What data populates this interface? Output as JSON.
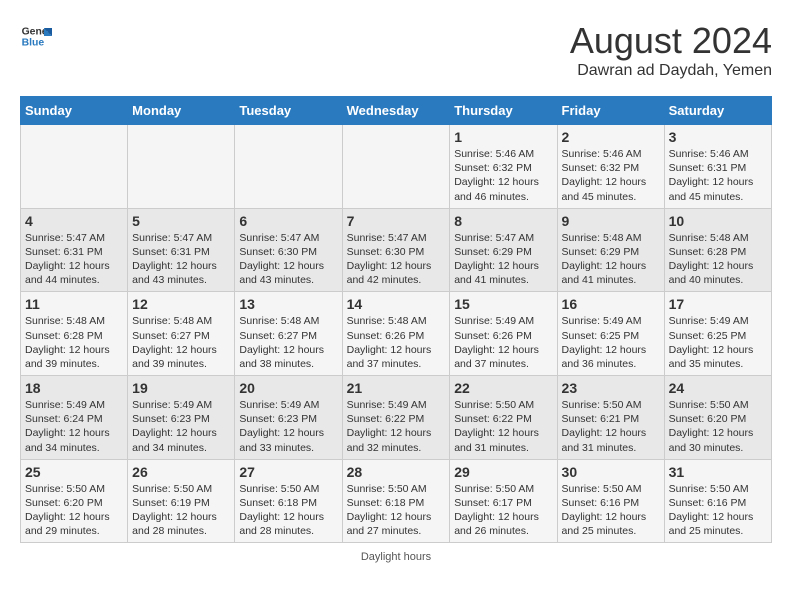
{
  "header": {
    "logo_line1": "General",
    "logo_line2": "Blue",
    "month_year": "August 2024",
    "location": "Dawran ad Daydah, Yemen"
  },
  "days_of_week": [
    "Sunday",
    "Monday",
    "Tuesday",
    "Wednesday",
    "Thursday",
    "Friday",
    "Saturday"
  ],
  "weeks": [
    [
      {
        "day": "",
        "info": ""
      },
      {
        "day": "",
        "info": ""
      },
      {
        "day": "",
        "info": ""
      },
      {
        "day": "",
        "info": ""
      },
      {
        "day": "1",
        "info": "Sunrise: 5:46 AM\nSunset: 6:32 PM\nDaylight: 12 hours and 46 minutes."
      },
      {
        "day": "2",
        "info": "Sunrise: 5:46 AM\nSunset: 6:32 PM\nDaylight: 12 hours and 45 minutes."
      },
      {
        "day": "3",
        "info": "Sunrise: 5:46 AM\nSunset: 6:31 PM\nDaylight: 12 hours and 45 minutes."
      }
    ],
    [
      {
        "day": "4",
        "info": "Sunrise: 5:47 AM\nSunset: 6:31 PM\nDaylight: 12 hours and 44 minutes."
      },
      {
        "day": "5",
        "info": "Sunrise: 5:47 AM\nSunset: 6:31 PM\nDaylight: 12 hours and 43 minutes."
      },
      {
        "day": "6",
        "info": "Sunrise: 5:47 AM\nSunset: 6:30 PM\nDaylight: 12 hours and 43 minutes."
      },
      {
        "day": "7",
        "info": "Sunrise: 5:47 AM\nSunset: 6:30 PM\nDaylight: 12 hours and 42 minutes."
      },
      {
        "day": "8",
        "info": "Sunrise: 5:47 AM\nSunset: 6:29 PM\nDaylight: 12 hours and 41 minutes."
      },
      {
        "day": "9",
        "info": "Sunrise: 5:48 AM\nSunset: 6:29 PM\nDaylight: 12 hours and 41 minutes."
      },
      {
        "day": "10",
        "info": "Sunrise: 5:48 AM\nSunset: 6:28 PM\nDaylight: 12 hours and 40 minutes."
      }
    ],
    [
      {
        "day": "11",
        "info": "Sunrise: 5:48 AM\nSunset: 6:28 PM\nDaylight: 12 hours and 39 minutes."
      },
      {
        "day": "12",
        "info": "Sunrise: 5:48 AM\nSunset: 6:27 PM\nDaylight: 12 hours and 39 minutes."
      },
      {
        "day": "13",
        "info": "Sunrise: 5:48 AM\nSunset: 6:27 PM\nDaylight: 12 hours and 38 minutes."
      },
      {
        "day": "14",
        "info": "Sunrise: 5:48 AM\nSunset: 6:26 PM\nDaylight: 12 hours and 37 minutes."
      },
      {
        "day": "15",
        "info": "Sunrise: 5:49 AM\nSunset: 6:26 PM\nDaylight: 12 hours and 37 minutes."
      },
      {
        "day": "16",
        "info": "Sunrise: 5:49 AM\nSunset: 6:25 PM\nDaylight: 12 hours and 36 minutes."
      },
      {
        "day": "17",
        "info": "Sunrise: 5:49 AM\nSunset: 6:25 PM\nDaylight: 12 hours and 35 minutes."
      }
    ],
    [
      {
        "day": "18",
        "info": "Sunrise: 5:49 AM\nSunset: 6:24 PM\nDaylight: 12 hours and 34 minutes."
      },
      {
        "day": "19",
        "info": "Sunrise: 5:49 AM\nSunset: 6:23 PM\nDaylight: 12 hours and 34 minutes."
      },
      {
        "day": "20",
        "info": "Sunrise: 5:49 AM\nSunset: 6:23 PM\nDaylight: 12 hours and 33 minutes."
      },
      {
        "day": "21",
        "info": "Sunrise: 5:49 AM\nSunset: 6:22 PM\nDaylight: 12 hours and 32 minutes."
      },
      {
        "day": "22",
        "info": "Sunrise: 5:50 AM\nSunset: 6:22 PM\nDaylight: 12 hours and 31 minutes."
      },
      {
        "day": "23",
        "info": "Sunrise: 5:50 AM\nSunset: 6:21 PM\nDaylight: 12 hours and 31 minutes."
      },
      {
        "day": "24",
        "info": "Sunrise: 5:50 AM\nSunset: 6:20 PM\nDaylight: 12 hours and 30 minutes."
      }
    ],
    [
      {
        "day": "25",
        "info": "Sunrise: 5:50 AM\nSunset: 6:20 PM\nDaylight: 12 hours and 29 minutes."
      },
      {
        "day": "26",
        "info": "Sunrise: 5:50 AM\nSunset: 6:19 PM\nDaylight: 12 hours and 28 minutes."
      },
      {
        "day": "27",
        "info": "Sunrise: 5:50 AM\nSunset: 6:18 PM\nDaylight: 12 hours and 28 minutes."
      },
      {
        "day": "28",
        "info": "Sunrise: 5:50 AM\nSunset: 6:18 PM\nDaylight: 12 hours and 27 minutes."
      },
      {
        "day": "29",
        "info": "Sunrise: 5:50 AM\nSunset: 6:17 PM\nDaylight: 12 hours and 26 minutes."
      },
      {
        "day": "30",
        "info": "Sunrise: 5:50 AM\nSunset: 6:16 PM\nDaylight: 12 hours and 25 minutes."
      },
      {
        "day": "31",
        "info": "Sunrise: 5:50 AM\nSunset: 6:16 PM\nDaylight: 12 hours and 25 minutes."
      }
    ]
  ],
  "footer": {
    "note": "Daylight hours"
  }
}
